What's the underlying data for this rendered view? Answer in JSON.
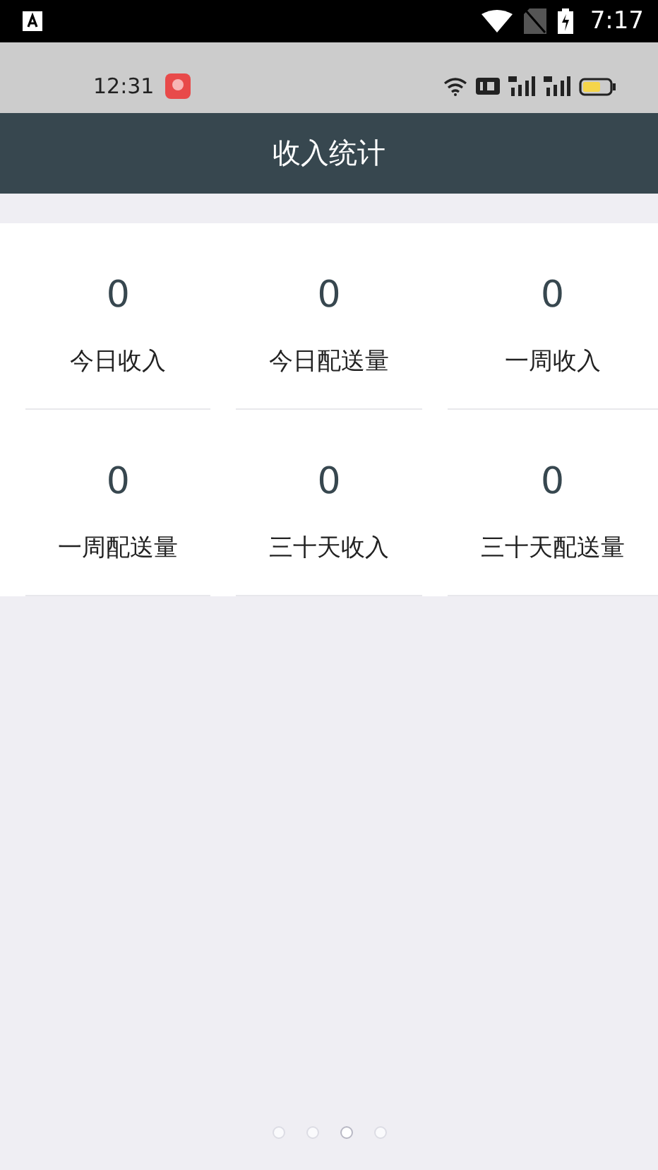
{
  "system_bar": {
    "time": "7:17"
  },
  "phone_status": {
    "time": "12:31"
  },
  "title": "收入统计",
  "stats": [
    {
      "value": "0",
      "label": "今日收入"
    },
    {
      "value": "0",
      "label": "今日配送量"
    },
    {
      "value": "0",
      "label": "一周收入"
    },
    {
      "value": "0",
      "label": "一周配送量"
    },
    {
      "value": "0",
      "label": "三十天收入"
    },
    {
      "value": "0",
      "label": "三十天配送量"
    }
  ],
  "page_dots": [
    {
      "selected": false
    },
    {
      "selected": false
    },
    {
      "selected": true
    },
    {
      "selected": false
    }
  ]
}
